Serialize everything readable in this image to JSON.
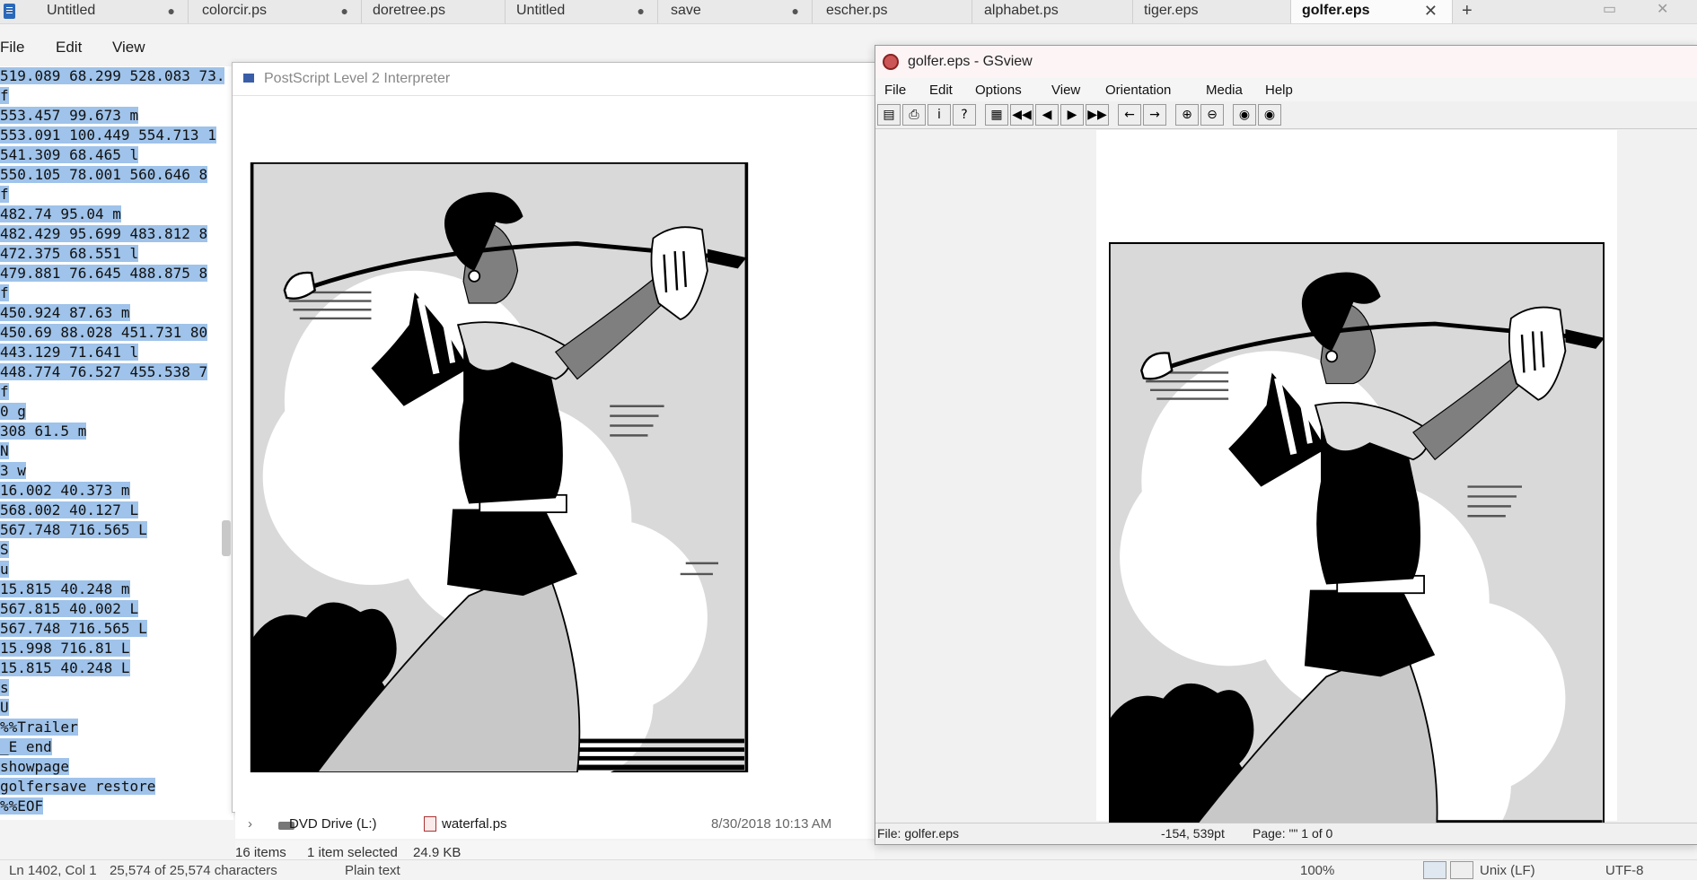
{
  "tabs": [
    {
      "label": "Untitled",
      "modified": "●"
    },
    {
      "label": "colorcir.ps",
      "modified": "●"
    },
    {
      "label": "doretree.ps",
      "modified": ""
    },
    {
      "label": "Untitled",
      "modified": "●"
    },
    {
      "label": "save",
      "modified": "●"
    },
    {
      "label": "escher.ps",
      "modified": ""
    },
    {
      "label": "alphabet.ps",
      "modified": ""
    },
    {
      "label": "tiger.eps",
      "modified": ""
    },
    {
      "label": "golfer.eps",
      "modified": ""
    }
  ],
  "tab_close": "✕",
  "tab_add": "+",
  "notepad": {
    "menu": [
      "File",
      "Edit",
      "View"
    ],
    "lines": [
      "519.089 68.299 528.083 73.",
      "f",
      "553.457 99.673 m",
      "553.091 100.449 554.713 1",
      "541.309 68.465 l",
      "550.105 78.001 560.646 8",
      "f",
      "482.74 95.04 m",
      "482.429 95.699 483.812 8",
      "472.375 68.551 l",
      "479.881 76.645 488.875 8",
      "f",
      "450.924 87.63 m",
      "450.69 88.028 451.731 80",
      "443.129 71.641 l",
      "448.774 76.527 455.538 7",
      "f",
      "0 g",
      "308 61.5 m",
      "N",
      "3 w",
      "16.002 40.373 m",
      "568.002 40.127 L",
      "567.748 716.565 L",
      "S",
      "u",
      "15.815 40.248 m",
      "567.815 40.002 L",
      "567.748 716.565 L",
      "15.998 716.81 L",
      "15.815 40.248 L",
      "s",
      "U",
      "%%Trailer",
      "_E end",
      "showpage",
      "golfersave restore",
      "%%EOF"
    ],
    "status": {
      "position": "Ln 1402, Col 1",
      "chars": "25,574 of 25,574 characters",
      "type": "Plain text",
      "zoom": "100%",
      "eol": "Unix (LF)",
      "encoding": "UTF-8"
    }
  },
  "ps_window": {
    "title": "PostScript Level 2 Interpreter"
  },
  "explorer": {
    "drive": "DVD Drive (L:)",
    "file": "waterfal.ps",
    "date": "8/30/2018 10:13 AM",
    "items": "16 items",
    "selected": "1 item selected",
    "size": "24.9 KB"
  },
  "gsview": {
    "title": "golfer.eps - GSview",
    "menu": [
      "File",
      "Edit",
      "Options",
      "View",
      "Orientation",
      "Media",
      "Help"
    ],
    "status": {
      "file": "File: golfer.eps",
      "coords": "-154, 539pt",
      "page": "Page: \"\" 1 of 0"
    }
  },
  "colors": {
    "selection": "#9fc3ea",
    "art_dark": "#000000",
    "art_mid": "#7f7f7f",
    "art_light": "#d9d9d9"
  }
}
